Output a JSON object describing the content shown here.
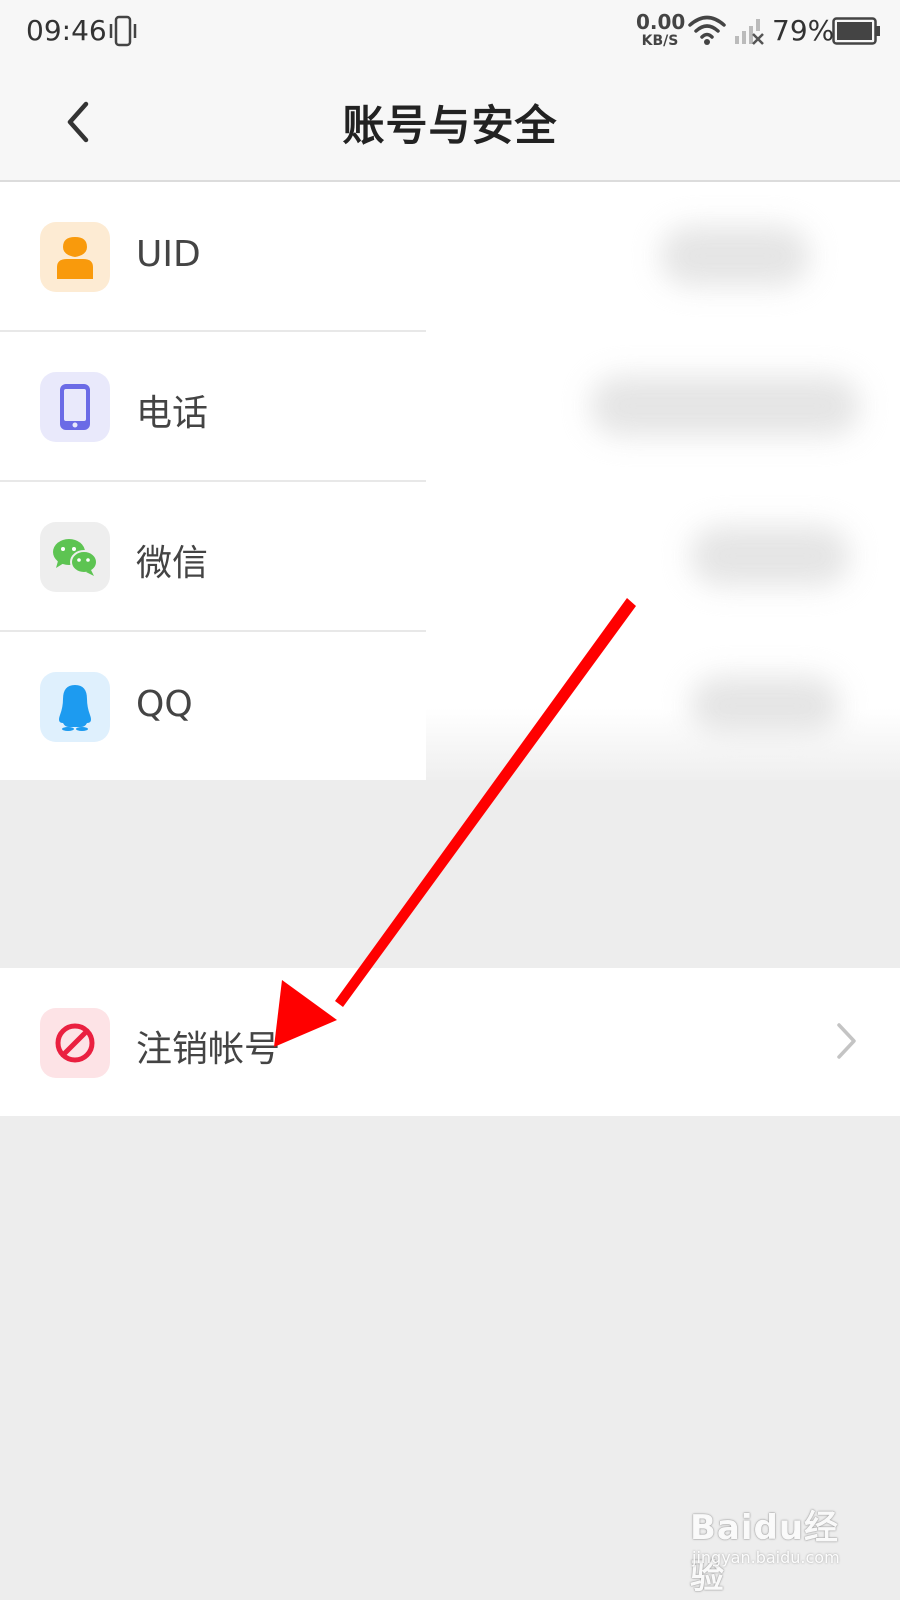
{
  "status_bar": {
    "time": "09:46",
    "net_speed_value": "0.00",
    "net_speed_unit": "KB/S",
    "battery_percent": "79%"
  },
  "header": {
    "title": "账号与安全",
    "back_icon": "chevron-left-icon"
  },
  "account_items": [
    {
      "label": "UID",
      "icon": "user-icon",
      "icon_bg": "#fdebd3",
      "icon_color": "#f99a0c"
    },
    {
      "label": "电话",
      "icon": "phone-icon",
      "icon_bg": "#e9e9fb",
      "icon_color": "#6b6be6"
    },
    {
      "label": "微信",
      "icon": "wechat-icon",
      "icon_bg": "#eeeeee",
      "icon_color": "#5dc452"
    },
    {
      "label": "QQ",
      "icon": "qq-penguin-icon",
      "icon_bg": "#dff0fd",
      "icon_color": "#1d9bf0"
    }
  ],
  "actions": {
    "deregister_label": "注销帐号",
    "deregister_icon": "prohibited-icon",
    "deregister_icon_bg": "#fde3e6",
    "deregister_icon_color": "#ea2040"
  },
  "watermark": {
    "logo": "Baidu经验",
    "url": "jingyan.baidu.com"
  },
  "colors": {
    "annotation_arrow": "#ff0000",
    "page_background": "#ededed"
  }
}
